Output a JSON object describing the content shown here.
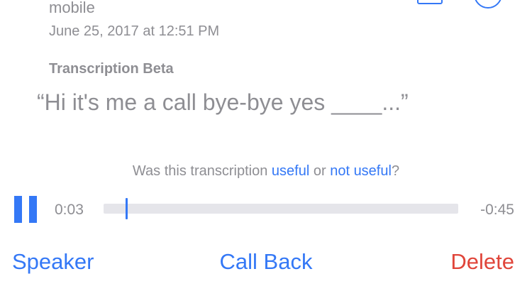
{
  "voicemail": {
    "source_label": "mobile",
    "date": "June 25, 2017 at 12:51 PM"
  },
  "transcription": {
    "title": "Transcription Beta",
    "text": "“Hi it's me a call bye-bye yes ____...”"
  },
  "feedback": {
    "prefix": "Was this transcription ",
    "useful_link": "useful",
    "middle": " or ",
    "not_useful_link": "not useful",
    "suffix": "?"
  },
  "player": {
    "state_icon": "pause-icon",
    "elapsed": "0:03",
    "remaining": "-0:45",
    "progress_fraction": 0.0625
  },
  "actions": {
    "speaker_label": "Speaker",
    "call_back_label": "Call Back",
    "delete_label": "Delete"
  },
  "colors": {
    "accent": "#3478f6",
    "destructive": "#e0453a",
    "secondary_text": "#8e8e93",
    "track": "#e5e5ea"
  }
}
